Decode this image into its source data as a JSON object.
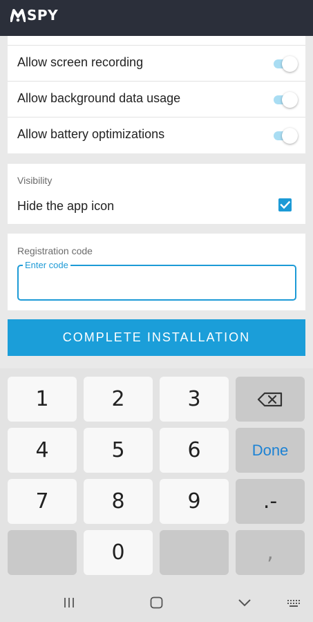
{
  "app": {
    "logo_text": "SPY"
  },
  "permissions": [
    {
      "label": "Allow screen recording",
      "enabled": true
    },
    {
      "label": "Allow background data usage",
      "enabled": true
    },
    {
      "label": "Allow battery optimizations",
      "enabled": true
    }
  ],
  "visibility": {
    "section_label": "Visibility",
    "hide_icon_label": "Hide the app icon",
    "hide_icon_checked": true
  },
  "registration": {
    "section_label": "Registration code",
    "field_label": "Enter code",
    "value": ""
  },
  "cta_label": "COMPLETE INSTALLATION",
  "keypad": {
    "keys": [
      "1",
      "2",
      "3",
      "4",
      "5",
      "6",
      "7",
      "8",
      "9",
      "0"
    ],
    "done_label": "Done",
    "dot_dash_label": ".-",
    "comma_label": ","
  },
  "colors": {
    "accent": "#1c9ad6",
    "appbar": "#2b2f3a",
    "toggle_track": "#a9ddf3"
  },
  "icons": {
    "backspace": "backspace-icon",
    "nav_recents": "recents-icon",
    "nav_home": "home-icon",
    "nav_back": "chevron-down-icon",
    "nav_keyboard": "keyboard-icon"
  }
}
